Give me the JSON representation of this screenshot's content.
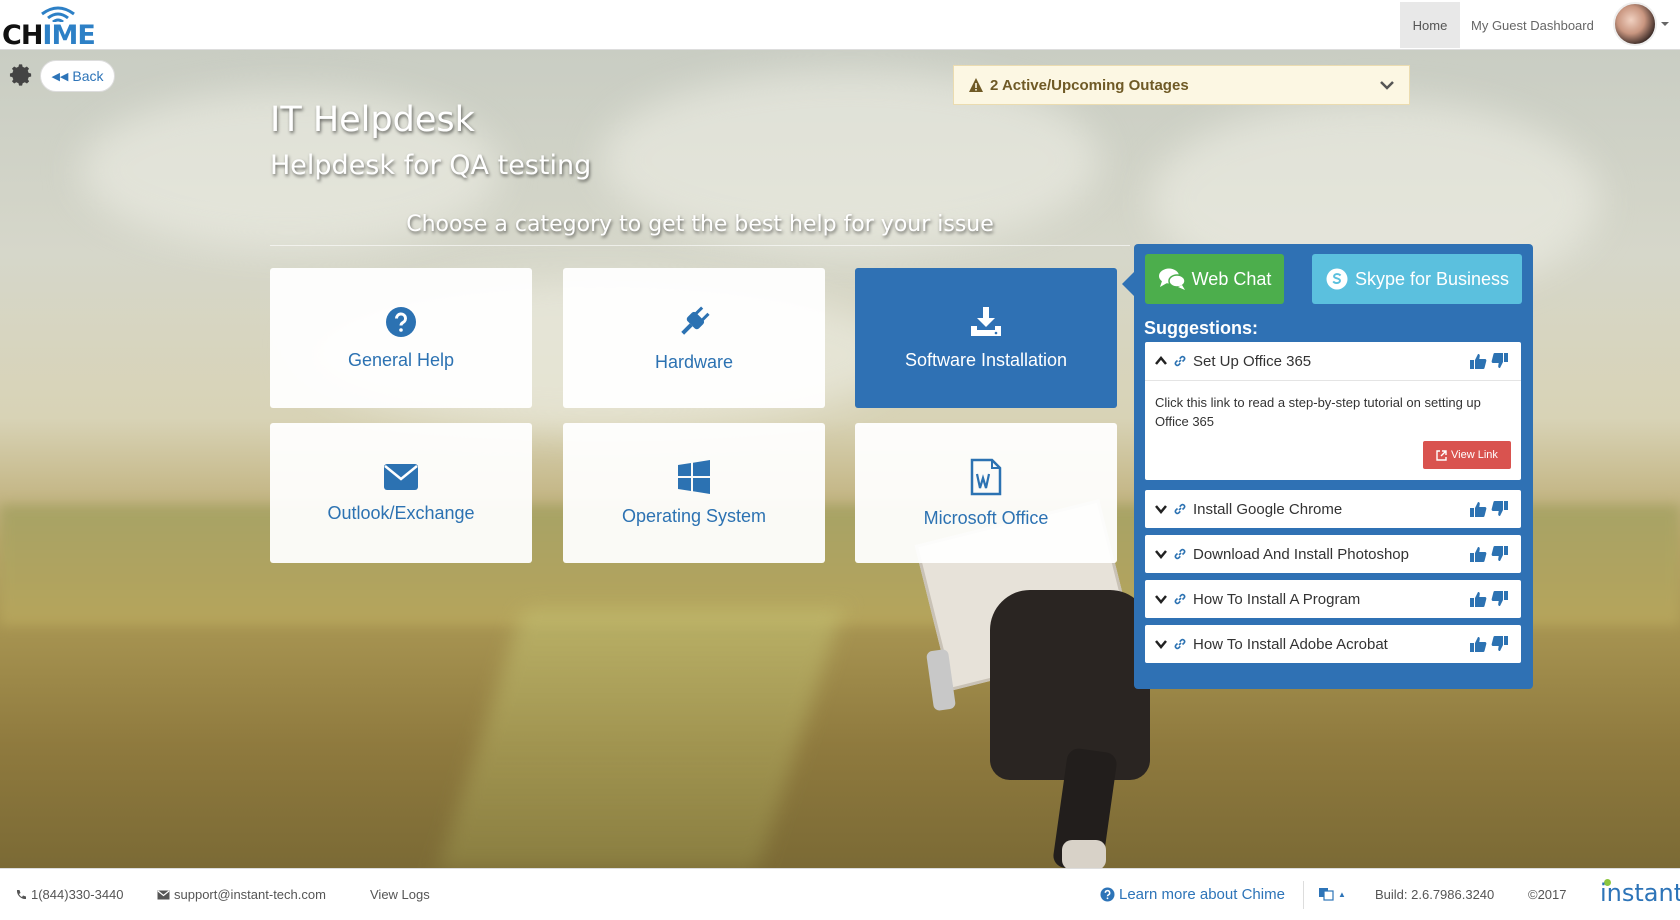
{
  "app": {
    "logo_text_left": "CH",
    "logo_text_i": "I",
    "logo_text_right": "ME"
  },
  "nav": {
    "home": "Home",
    "dashboard": "My Guest Dashboard"
  },
  "toolbar": {
    "back": "Back"
  },
  "outages": {
    "label": "2 Active/Upcoming Outages"
  },
  "header": {
    "title": "IT Helpdesk",
    "subtitle": "Helpdesk for QA testing",
    "choose": "Choose a category to get the best help for your issue"
  },
  "categories": [
    {
      "label": "General Help",
      "icon": "question-circle-icon"
    },
    {
      "label": "Hardware",
      "icon": "plug-icon"
    },
    {
      "label": "Software Installation",
      "icon": "download-icon",
      "active": true
    },
    {
      "label": "Outlook/Exchange",
      "icon": "envelope-icon"
    },
    {
      "label": "Operating System",
      "icon": "windows-icon"
    },
    {
      "label": "Microsoft Office",
      "icon": "word-file-icon"
    }
  ],
  "panel": {
    "web_chat": "Web Chat",
    "skype": "Skype for Business",
    "suggestions_title": "Suggestions:",
    "items": [
      {
        "label": "Set Up Office 365",
        "expanded": true,
        "description": "Click this link to read a step-by-step tutorial on setting up Office 365",
        "button": "View Link"
      },
      {
        "label": "Install Google Chrome"
      },
      {
        "label": "Download And Install Photoshop"
      },
      {
        "label": "How To Install A Program"
      },
      {
        "label": "How To Install Adobe Acrobat"
      }
    ]
  },
  "footer": {
    "phone": "1(844)330-3440",
    "email": "support@instant-tech.com",
    "logs": "View Logs",
    "learn": "Learn more about Chime",
    "build": "Build: 2.6.7986.3240",
    "copyright": "©2017",
    "brand": "instant"
  },
  "colors": {
    "primary": "#2f71b4",
    "chat_green": "#4cae4c",
    "skype_cyan": "#5bc0de",
    "danger": "#d9534f",
    "outage_bg": "#fcf7e3"
  }
}
